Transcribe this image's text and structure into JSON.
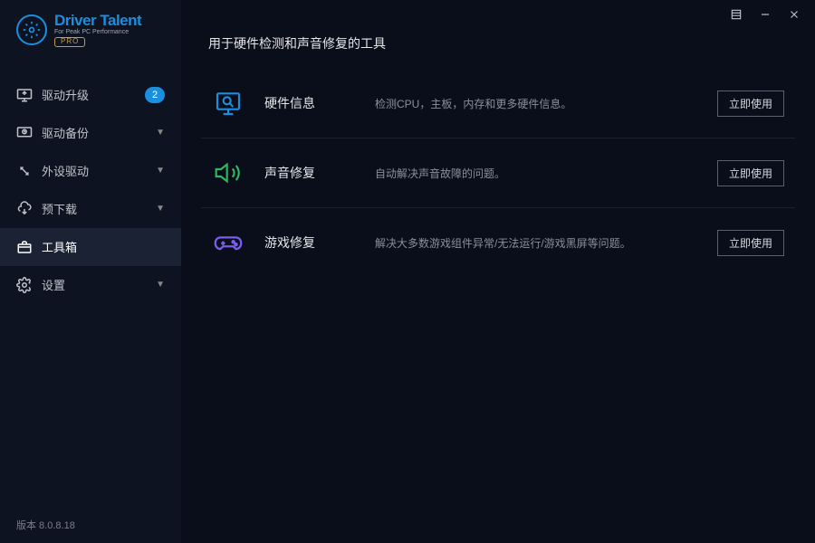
{
  "app": {
    "name": "Driver Talent",
    "tagline": "For Peak PC Performance",
    "edition": "PRO",
    "version_label": "版本 8.0.8.18"
  },
  "sidebar": {
    "items": [
      {
        "label": "驱动升级",
        "badge": "2"
      },
      {
        "label": "驱动备份"
      },
      {
        "label": "外设驱动"
      },
      {
        "label": "预下载"
      },
      {
        "label": "工具箱"
      },
      {
        "label": "设置"
      }
    ]
  },
  "page": {
    "title": "用于硬件检测和声音修复的工具",
    "tools": [
      {
        "name": "硬件信息",
        "desc": "检测CPU，主板，内存和更多硬件信息。",
        "action": "立即使用"
      },
      {
        "name": "声音修复",
        "desc": "自动解决声音故障的问题。",
        "action": "立即使用"
      },
      {
        "name": "游戏修复",
        "desc": "解决大多数游戏组件异常/无法运行/游戏黑屏等问题。",
        "action": "立即使用"
      }
    ]
  }
}
